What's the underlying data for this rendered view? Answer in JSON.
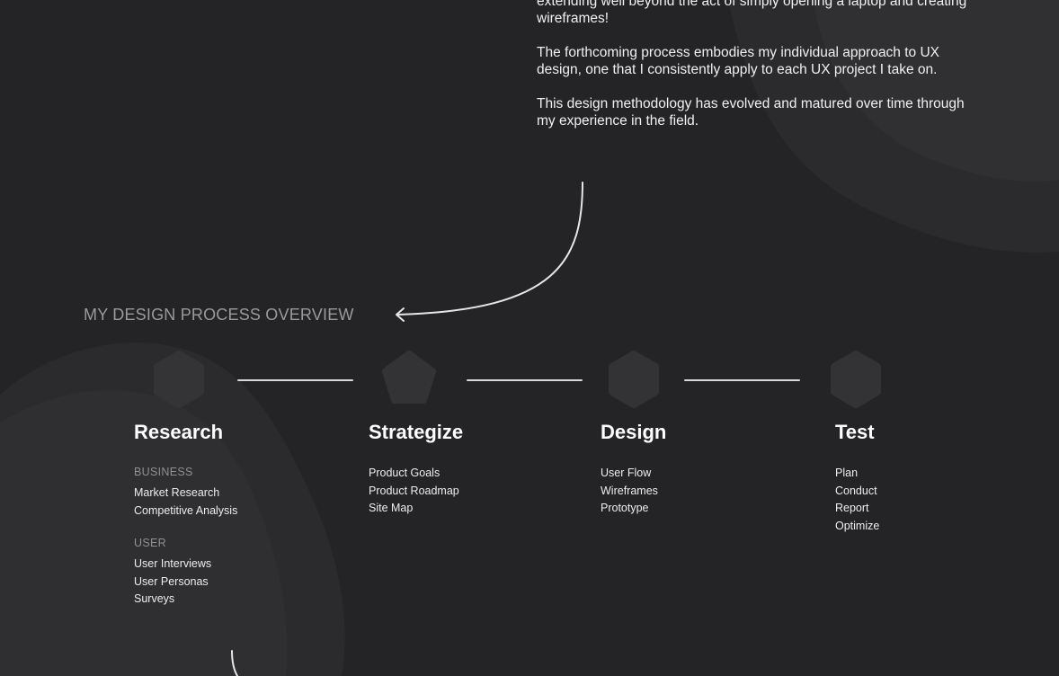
{
  "intro": {
    "paragraphs": [
      "extending well beyond the act of simply opening a laptop and creating wireframes!",
      "The forthcoming process embodies my individual approach to UX design, one that I consistently apply to each UX project I take on.",
      "This design methodology has evolved and matured over time through my experience in the field."
    ]
  },
  "section": {
    "title": "MY DESIGN PROCESS OVERVIEW"
  },
  "process": {
    "research": {
      "title": "Research",
      "groups": [
        {
          "label": "BUSINESS",
          "items": [
            "Market Research",
            "Competitive Analysis"
          ]
        },
        {
          "label": "USER",
          "items": [
            "User Interviews",
            "User Personas",
            "Surveys"
          ]
        }
      ]
    },
    "strategize": {
      "title": "Strategize",
      "items": [
        "Product Goals",
        "Product Roadmap",
        "Site Map"
      ]
    },
    "design": {
      "title": "Design",
      "items": [
        "User Flow",
        "Wireframes",
        "Prototype"
      ]
    },
    "test": {
      "title": "Test",
      "items": [
        "Plan",
        "Conduct",
        "Report",
        "Optimize"
      ]
    }
  },
  "colors": {
    "background": "#242426",
    "accent_text": "#ffffff",
    "muted_text": "#9a9a9e",
    "connector": "#d9d9dc"
  },
  "icons": {
    "arrow": "curved-arrow-icon",
    "step_marker": "hexagon-icon"
  }
}
